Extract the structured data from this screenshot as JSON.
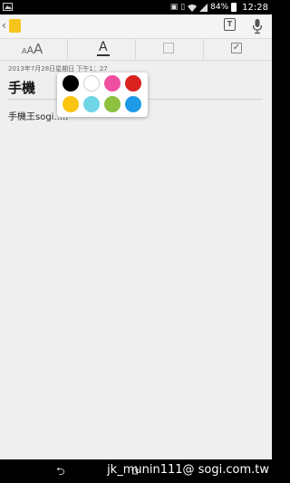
{
  "status_bar": {
    "battery": "84%",
    "time": "12:28"
  },
  "toolbar": {
    "font_size_glyphs": [
      "A",
      "A",
      "A"
    ],
    "font_color_glyph": "A"
  },
  "note": {
    "date": "2013年7月28日星期日 下午1：27",
    "title": "手機",
    "body": "手機王sogi....."
  },
  "color_picker": {
    "colors": [
      "#000000",
      "#ffffff",
      "#ee4fa0",
      "#d9221e",
      "#fbc411",
      "#6fd4e6",
      "#8cc03e",
      "#1e9be6"
    ]
  },
  "watermark": "jk_munin111@ sogi.com.tw",
  "icons": {
    "back": "chevron-left-icon",
    "note_color": "note-color-icon",
    "text_format": "text-format-icon",
    "mic": "microphone-icon"
  }
}
